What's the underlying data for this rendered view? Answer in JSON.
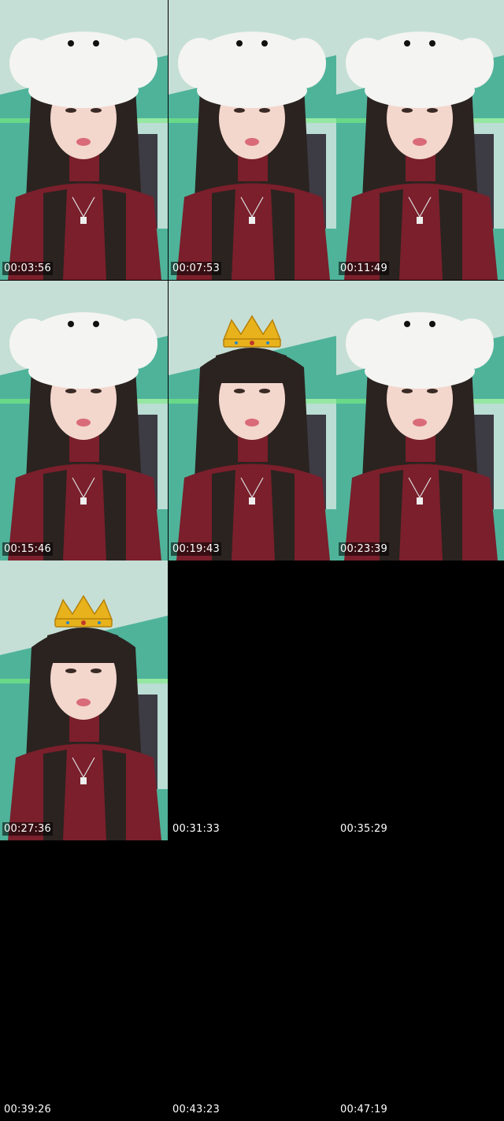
{
  "frames": [
    {
      "timestamp": "00:03:56",
      "overlay": "bear-hat",
      "has_frame": true
    },
    {
      "timestamp": "00:07:53",
      "overlay": "bear-hat",
      "has_frame": true
    },
    {
      "timestamp": "00:11:49",
      "overlay": "bear-hat",
      "has_frame": true
    },
    {
      "timestamp": "00:15:46",
      "overlay": "bear-hat",
      "has_frame": true
    },
    {
      "timestamp": "00:19:43",
      "overlay": "crown",
      "has_frame": true
    },
    {
      "timestamp": "00:23:39",
      "overlay": "bear-hat",
      "has_frame": true
    },
    {
      "timestamp": "00:27:36",
      "overlay": "crown",
      "has_frame": true
    },
    {
      "timestamp": "00:31:33",
      "overlay": "none",
      "has_frame": false
    },
    {
      "timestamp": "00:35:29",
      "overlay": "none",
      "has_frame": false
    },
    {
      "timestamp": "00:39:26",
      "overlay": "none",
      "has_frame": false
    },
    {
      "timestamp": "00:43:23",
      "overlay": "none",
      "has_frame": false
    },
    {
      "timestamp": "00:47:19",
      "overlay": "none",
      "has_frame": false
    }
  ],
  "colors": {
    "wall": "#4fb39a",
    "ceiling": "#d9e6e0",
    "shirt": "#7a1f2b",
    "hair": "#2b2320",
    "skin": "#f3d6cc",
    "hat": "#f4f4f2",
    "crown": "#e8b21c"
  }
}
